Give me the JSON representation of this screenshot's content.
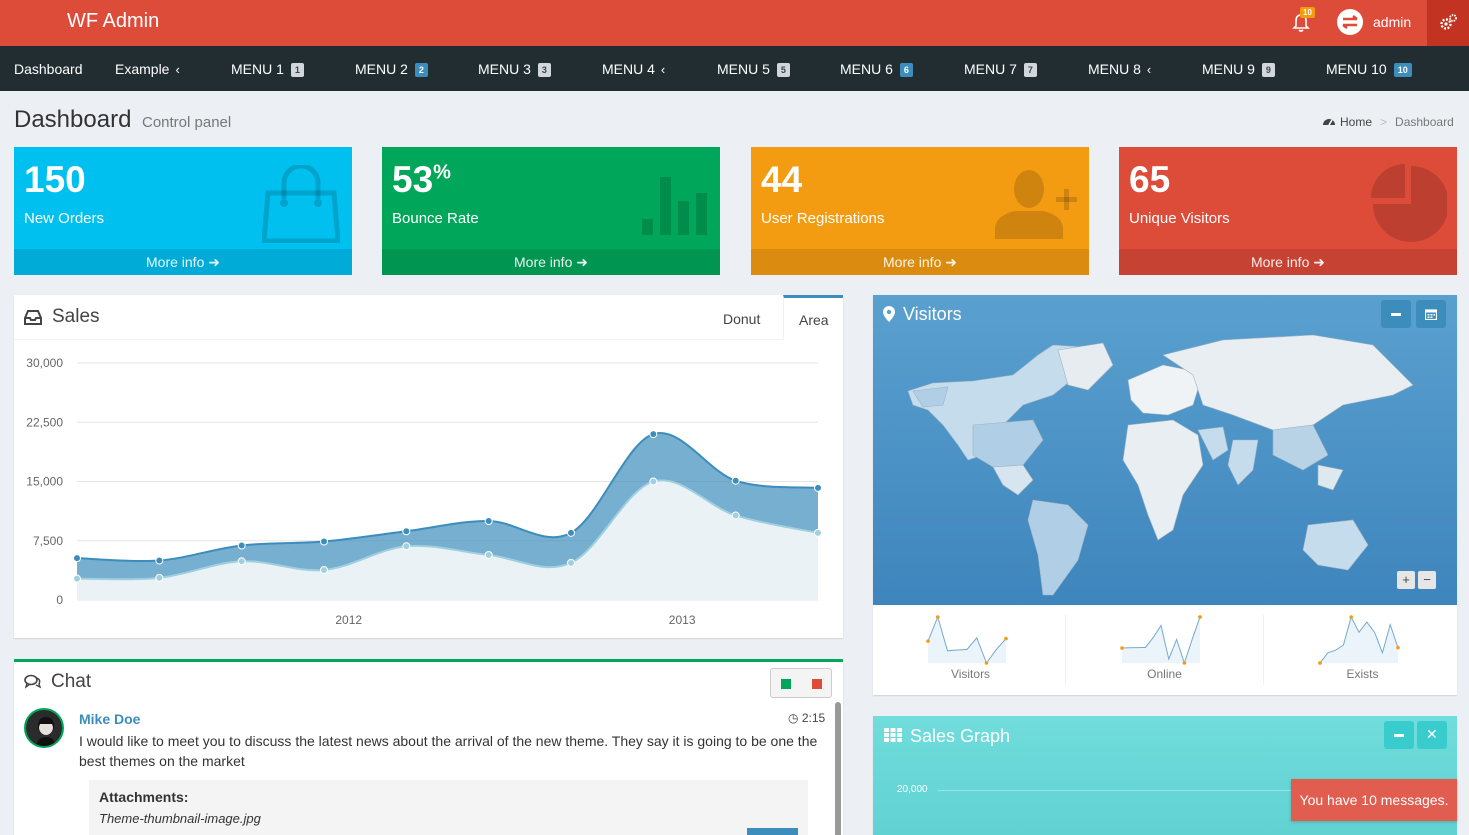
{
  "header": {
    "brand": "WF Admin",
    "notif_count": "10",
    "user_name": "admin"
  },
  "nav": [
    {
      "label": "Dashboard",
      "badge": "",
      "badge_style": "",
      "chevron": false
    },
    {
      "label": "Example",
      "badge": "",
      "badge_style": "",
      "chevron": true
    },
    {
      "label": "MENU 1",
      "badge": "1",
      "badge_style": "gray",
      "chevron": false
    },
    {
      "label": "MENU 2",
      "badge": "2",
      "badge_style": "blue",
      "chevron": false
    },
    {
      "label": "MENU 3",
      "badge": "3",
      "badge_style": "gray",
      "chevron": false
    },
    {
      "label": "MENU 4",
      "badge": "",
      "badge_style": "",
      "chevron": true
    },
    {
      "label": "MENU 5",
      "badge": "5",
      "badge_style": "gray",
      "chevron": false
    },
    {
      "label": "MENU 6",
      "badge": "6",
      "badge_style": "blue",
      "chevron": false
    },
    {
      "label": "MENU 7",
      "badge": "7",
      "badge_style": "gray",
      "chevron": false
    },
    {
      "label": "MENU 8",
      "badge": "",
      "badge_style": "",
      "chevron": true
    },
    {
      "label": "MENU 9",
      "badge": "9",
      "badge_style": "gray",
      "chevron": false
    },
    {
      "label": "MENU 10",
      "badge": "10",
      "badge_style": "blue",
      "chevron": false
    }
  ],
  "page": {
    "title": "Dashboard",
    "subtitle": "Control panel",
    "breadcrumb": {
      "home": "Home",
      "current": "Dashboard"
    }
  },
  "stats": [
    {
      "value": "150",
      "suffix": "",
      "label": "New Orders",
      "more": "More info",
      "icon": "shopping-bag-icon",
      "color": "#00c0ef"
    },
    {
      "value": "53",
      "suffix": "%",
      "label": "Bounce Rate",
      "more": "More info",
      "icon": "bar-chart-icon",
      "color": "#00a65a"
    },
    {
      "value": "44",
      "suffix": "",
      "label": "User Registrations",
      "more": "More info",
      "icon": "user-add-icon",
      "color": "#f39c12"
    },
    {
      "value": "65",
      "suffix": "",
      "label": "Unique Visitors",
      "more": "More info",
      "icon": "pie-chart-icon",
      "color": "#dd4b39"
    }
  ],
  "sales": {
    "title": "Sales",
    "tabs": [
      "Donut",
      "Area"
    ],
    "active_tab": "Area"
  },
  "chart_data": {
    "type": "area",
    "title": "",
    "xlabel": "",
    "ylabel": "",
    "x_ticks": [
      "2012",
      "2013"
    ],
    "y_ticks": [
      "30,000",
      "22,500",
      "15,000",
      "7,500",
      "0"
    ],
    "ylim": [
      0,
      30000
    ],
    "x": [
      0,
      1,
      2,
      3,
      4,
      5,
      6,
      7,
      8,
      9
    ],
    "series": [
      {
        "values": [
          5300,
          5000,
          6900,
          7400,
          8700,
          10000,
          8500,
          21000,
          15100,
          14200
        ]
      },
      {
        "values": [
          2700,
          2800,
          4900,
          3800,
          6800,
          5700,
          4700,
          15000,
          10700,
          8500
        ]
      }
    ],
    "colors": [
      "#3c8dbc",
      "#a0d0e0"
    ],
    "grid": true
  },
  "chat": {
    "title": "Chat",
    "messages": [
      {
        "name": "Mike Doe",
        "time": "2:15",
        "text": "I would like to meet you to discuss the latest news about the arrival of the new theme. They say it is going to be one the best themes on the market",
        "attachments_title": "Attachments:",
        "attachment": "Theme-thumbnail-image.jpg"
      }
    ]
  },
  "visitors": {
    "title": "Visitors",
    "sparklines": [
      {
        "label": "Visitors",
        "values": [
          1000,
          1200,
          920,
          927,
          931,
          1027,
          819,
          930,
          1021
        ]
      },
      {
        "label": "Online",
        "values": [
          515,
          519,
          520,
          522,
          652,
          810,
          370,
          627,
          319,
          630,
          921
        ]
      },
      {
        "label": "Exists",
        "values": [
          15,
          19,
          20,
          22,
          33,
          27,
          31,
          27,
          19,
          30,
          21
        ]
      }
    ],
    "zoom_in": "+",
    "zoom_out": "−"
  },
  "sales_graph": {
    "title": "Sales Graph",
    "y_tick": "20,000"
  },
  "toast": {
    "text": "You have 10 messages."
  }
}
